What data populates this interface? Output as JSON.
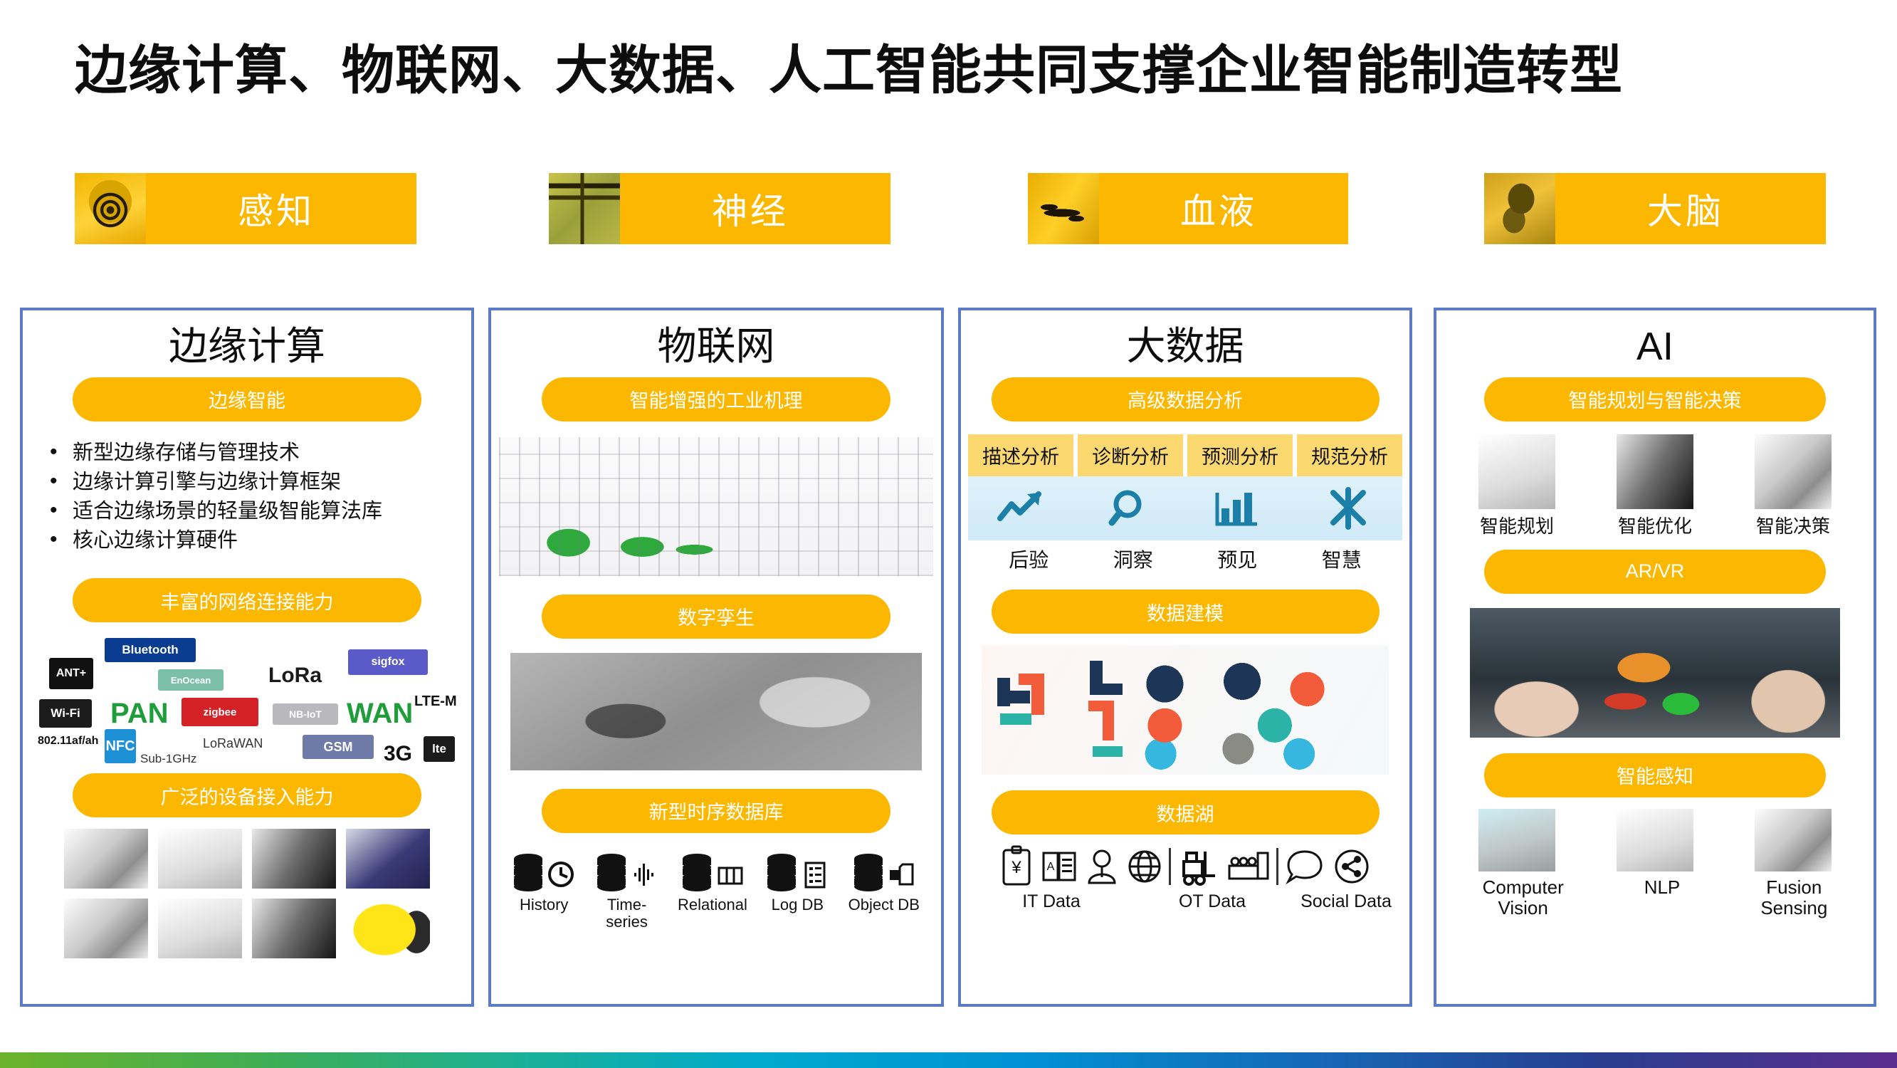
{
  "title": "边缘计算、物联网、大数据、人工智能共同支撑企业智能制造转型",
  "accent": "#FCB700",
  "chip_color": "#FBD870",
  "card_border": "#5B7CC4",
  "banners": [
    {
      "label": "感知",
      "icon": "eye-sensor-icon"
    },
    {
      "label": "神经",
      "icon": "neuron-network-icon"
    },
    {
      "label": "血液",
      "icon": "blood-vessel-icon"
    },
    {
      "label": "大脑",
      "icon": "brain-icon"
    }
  ],
  "columns": [
    {
      "title": "边缘计算",
      "sections": [
        {
          "pill": "边缘智能"
        },
        {
          "pill": "丰富的网络连接能力"
        },
        {
          "pill": "广泛的设备接入能力"
        }
      ],
      "bullets": [
        "新型边缘存储与管理技术",
        "边缘计算引擎与边缘计算框架",
        "适合边缘场景的轻量级智能算法库",
        "核心边缘计算硬件"
      ],
      "network_logos": [
        "ANT+",
        "Bluetooth",
        "EnOcean",
        "LoRa",
        "sigfox",
        "Wi-Fi",
        "PAN",
        "zigbee",
        "NB-IoT",
        "WAN",
        "LTE-M",
        "802.11af/ah",
        "NFC",
        "Sub-1GHz",
        "LoRaWAN",
        "GSM",
        "3G",
        "lte"
      ]
    },
    {
      "title": "物联网",
      "sections": [
        {
          "pill": "智能增强的工业机理"
        },
        {
          "pill": "数字孪生"
        },
        {
          "pill": "新型时序数据库"
        }
      ],
      "databases": [
        {
          "label": "History",
          "icon": "database-clock-icon"
        },
        {
          "label": "Time-series",
          "icon": "database-waveform-icon"
        },
        {
          "label": "Relational",
          "icon": "database-table-icon"
        },
        {
          "label": "Log DB",
          "icon": "database-log-icon"
        },
        {
          "label": "Object DB",
          "icon": "database-object-icon"
        }
      ]
    },
    {
      "title": "大数据",
      "sections": [
        {
          "pill": "高级数据分析"
        },
        {
          "pill": "数据建模"
        },
        {
          "pill": "数据湖"
        }
      ],
      "analytics_chips": [
        "描述分析",
        "诊断分析",
        "预测分析",
        "规范分析"
      ],
      "analytics_icons": [
        "trend-arrow-icon",
        "magnifier-icon",
        "bar-chart-icon",
        "compass-icon"
      ],
      "analytics_outcomes": [
        "后验",
        "洞察",
        "预见",
        "智慧"
      ],
      "lake_icons": [
        "erp-finance-icon",
        "card-record-icon",
        "person-icon",
        "globe-icon",
        "forklift-icon",
        "factory-line-icon",
        "speech-bubble-icon",
        "share-icon"
      ],
      "lake_labels": [
        "IT Data",
        "OT Data",
        "Social Data"
      ]
    },
    {
      "title": "AI",
      "sections": [
        {
          "pill": "智能规划与智能决策"
        },
        {
          "pill": "AR/VR"
        },
        {
          "pill": "智能感知"
        }
      ],
      "planning_labels": [
        "智能规划",
        "智能优化",
        "智能决策"
      ],
      "perception_labels": [
        "Computer Vision",
        "NLP",
        "Fusion Sensing"
      ]
    }
  ]
}
